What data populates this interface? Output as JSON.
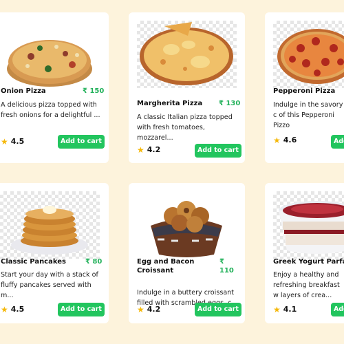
{
  "currency": "₹",
  "colors": {
    "page_bg": "#fdf3dc",
    "card_bg": "#ffffff",
    "accent": "#22c55e",
    "price": "#22b15a",
    "star": "#f5b80a"
  },
  "items": [
    {
      "name": "Onion Pizza",
      "price": "₹ 150",
      "description": "A delicious pizza topped with fresh onions for a delightful ...",
      "rating": "4.5",
      "button": "Add to cart",
      "image_icon": "onion-pizza-image"
    },
    {
      "name": "Margherita Pizza",
      "price": "₹ 130",
      "description": "A classic Italian pizza topped with fresh tomatoes, mozzarel...",
      "rating": "4.2",
      "button": "Add to cart",
      "image_icon": "margherita-pizza-image"
    },
    {
      "name": "Pepperoni Pizza",
      "price": "",
      "description": "Indulge in the savory c of this Pepperoni Pizzo",
      "rating": "4.6",
      "button": "Add",
      "image_icon": "pepperoni-pizza-image"
    },
    {
      "name": "Classic Pancakes",
      "price": "₹ 80",
      "description": "Start your day with a stack of fluffy pancakes served with m...",
      "rating": "4.5",
      "button": "Add to cart",
      "image_icon": "pancakes-image"
    },
    {
      "name": "Egg and Bacon Croissant",
      "price": "₹ 110",
      "description": "Indulge in a buttery croissant filled with scrambled eggs, c...",
      "rating": "4.2",
      "button": "Add to cart",
      "image_icon": "croissant-basket-image"
    },
    {
      "name": "Greek Yogurt Parfait",
      "price": "",
      "description": "Enjoy a healthy and refreshing breakfast w layers of crea...",
      "rating": "4.1",
      "button": "Add",
      "image_icon": "yogurt-parfait-image"
    }
  ]
}
